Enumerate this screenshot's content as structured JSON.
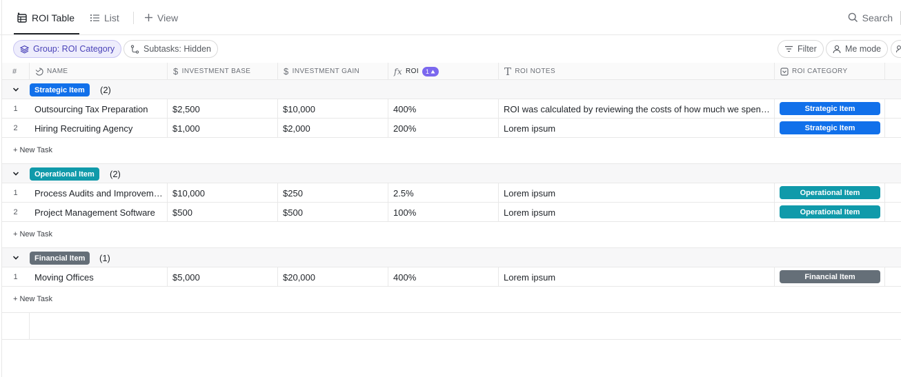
{
  "tabs": [
    {
      "label": "ROI Table",
      "icon": "table-icon",
      "active": true
    },
    {
      "label": "List",
      "icon": "list-icon",
      "active": false
    },
    {
      "label": "View",
      "icon": "plus-icon",
      "active": false
    }
  ],
  "search": {
    "label": "Search"
  },
  "toolbar": {
    "group_label": "Group: ROI Category",
    "subtasks_label": "Subtasks: Hidden",
    "filter_label": "Filter",
    "me_mode_label": "Me mode"
  },
  "columns": {
    "index": "#",
    "name": "NAME",
    "investment_base": "INVESTMENT BASE",
    "investment_gain": "INVESTMENT GAIN",
    "roi": "ROI",
    "roi_sort_badge": "1",
    "roi_notes": "ROI NOTES",
    "roi_category": "ROI CATEGORY"
  },
  "colors": {
    "strategic": "#1170ea",
    "operational": "#109aaa",
    "financial": "#656f78",
    "accent": "#7b68ee"
  },
  "new_task_label": "+ New Task",
  "groups": [
    {
      "name": "Strategic Item",
      "count": "(2)",
      "rows": [
        {
          "index": "1",
          "name": "Outsourcing Tax Preparation",
          "base": "$2,500",
          "gain": "$10,000",
          "roi": "400%",
          "notes": "ROI was calculated by reviewing the costs of how much we spent in the past on tax preparation",
          "category": "Strategic Item"
        },
        {
          "index": "2",
          "name": "Hiring Recruiting Agency",
          "base": "$1,000",
          "gain": "$2,000",
          "roi": "200%",
          "notes": "Lorem ipsum",
          "category": "Strategic Item"
        }
      ]
    },
    {
      "name": "Operational Item",
      "count": "(2)",
      "rows": [
        {
          "index": "1",
          "name": "Process Audits and Improvements",
          "base": "$10,000",
          "gain": "$250",
          "roi": "2.5%",
          "notes": "Lorem ipsum",
          "category": "Operational Item"
        },
        {
          "index": "2",
          "name": "Project Management Software",
          "base": "$500",
          "gain": "$500",
          "roi": "100%",
          "notes": "Lorem ipsum",
          "category": "Operational Item"
        }
      ]
    },
    {
      "name": "Financial Item",
      "count": "(1)",
      "rows": [
        {
          "index": "1",
          "name": "Moving Offices",
          "base": "$5,000",
          "gain": "$20,000",
          "roi": "400%",
          "notes": "Lorem ipsum",
          "category": "Financial Item"
        }
      ]
    }
  ]
}
